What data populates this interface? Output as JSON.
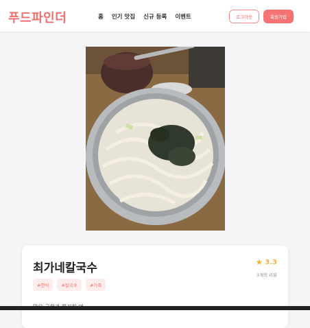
{
  "header": {
    "logo": "푸드파인더",
    "nav": [
      "홈",
      "인기 맛집",
      "신규 등록",
      "이벤트"
    ],
    "login_label": "로그아웃",
    "signup_label": "회원가입"
  },
  "restaurant": {
    "name": "최가네칼국수",
    "tags": [
      "#한식",
      "#칼국수",
      "#가족"
    ],
    "rating": "3.3",
    "review_count": "3개의 리뷰",
    "description": "맑은 국물과 쫄깃한 면"
  },
  "colors": {
    "brand": "#f26d6d",
    "star": "#f3b33d"
  }
}
